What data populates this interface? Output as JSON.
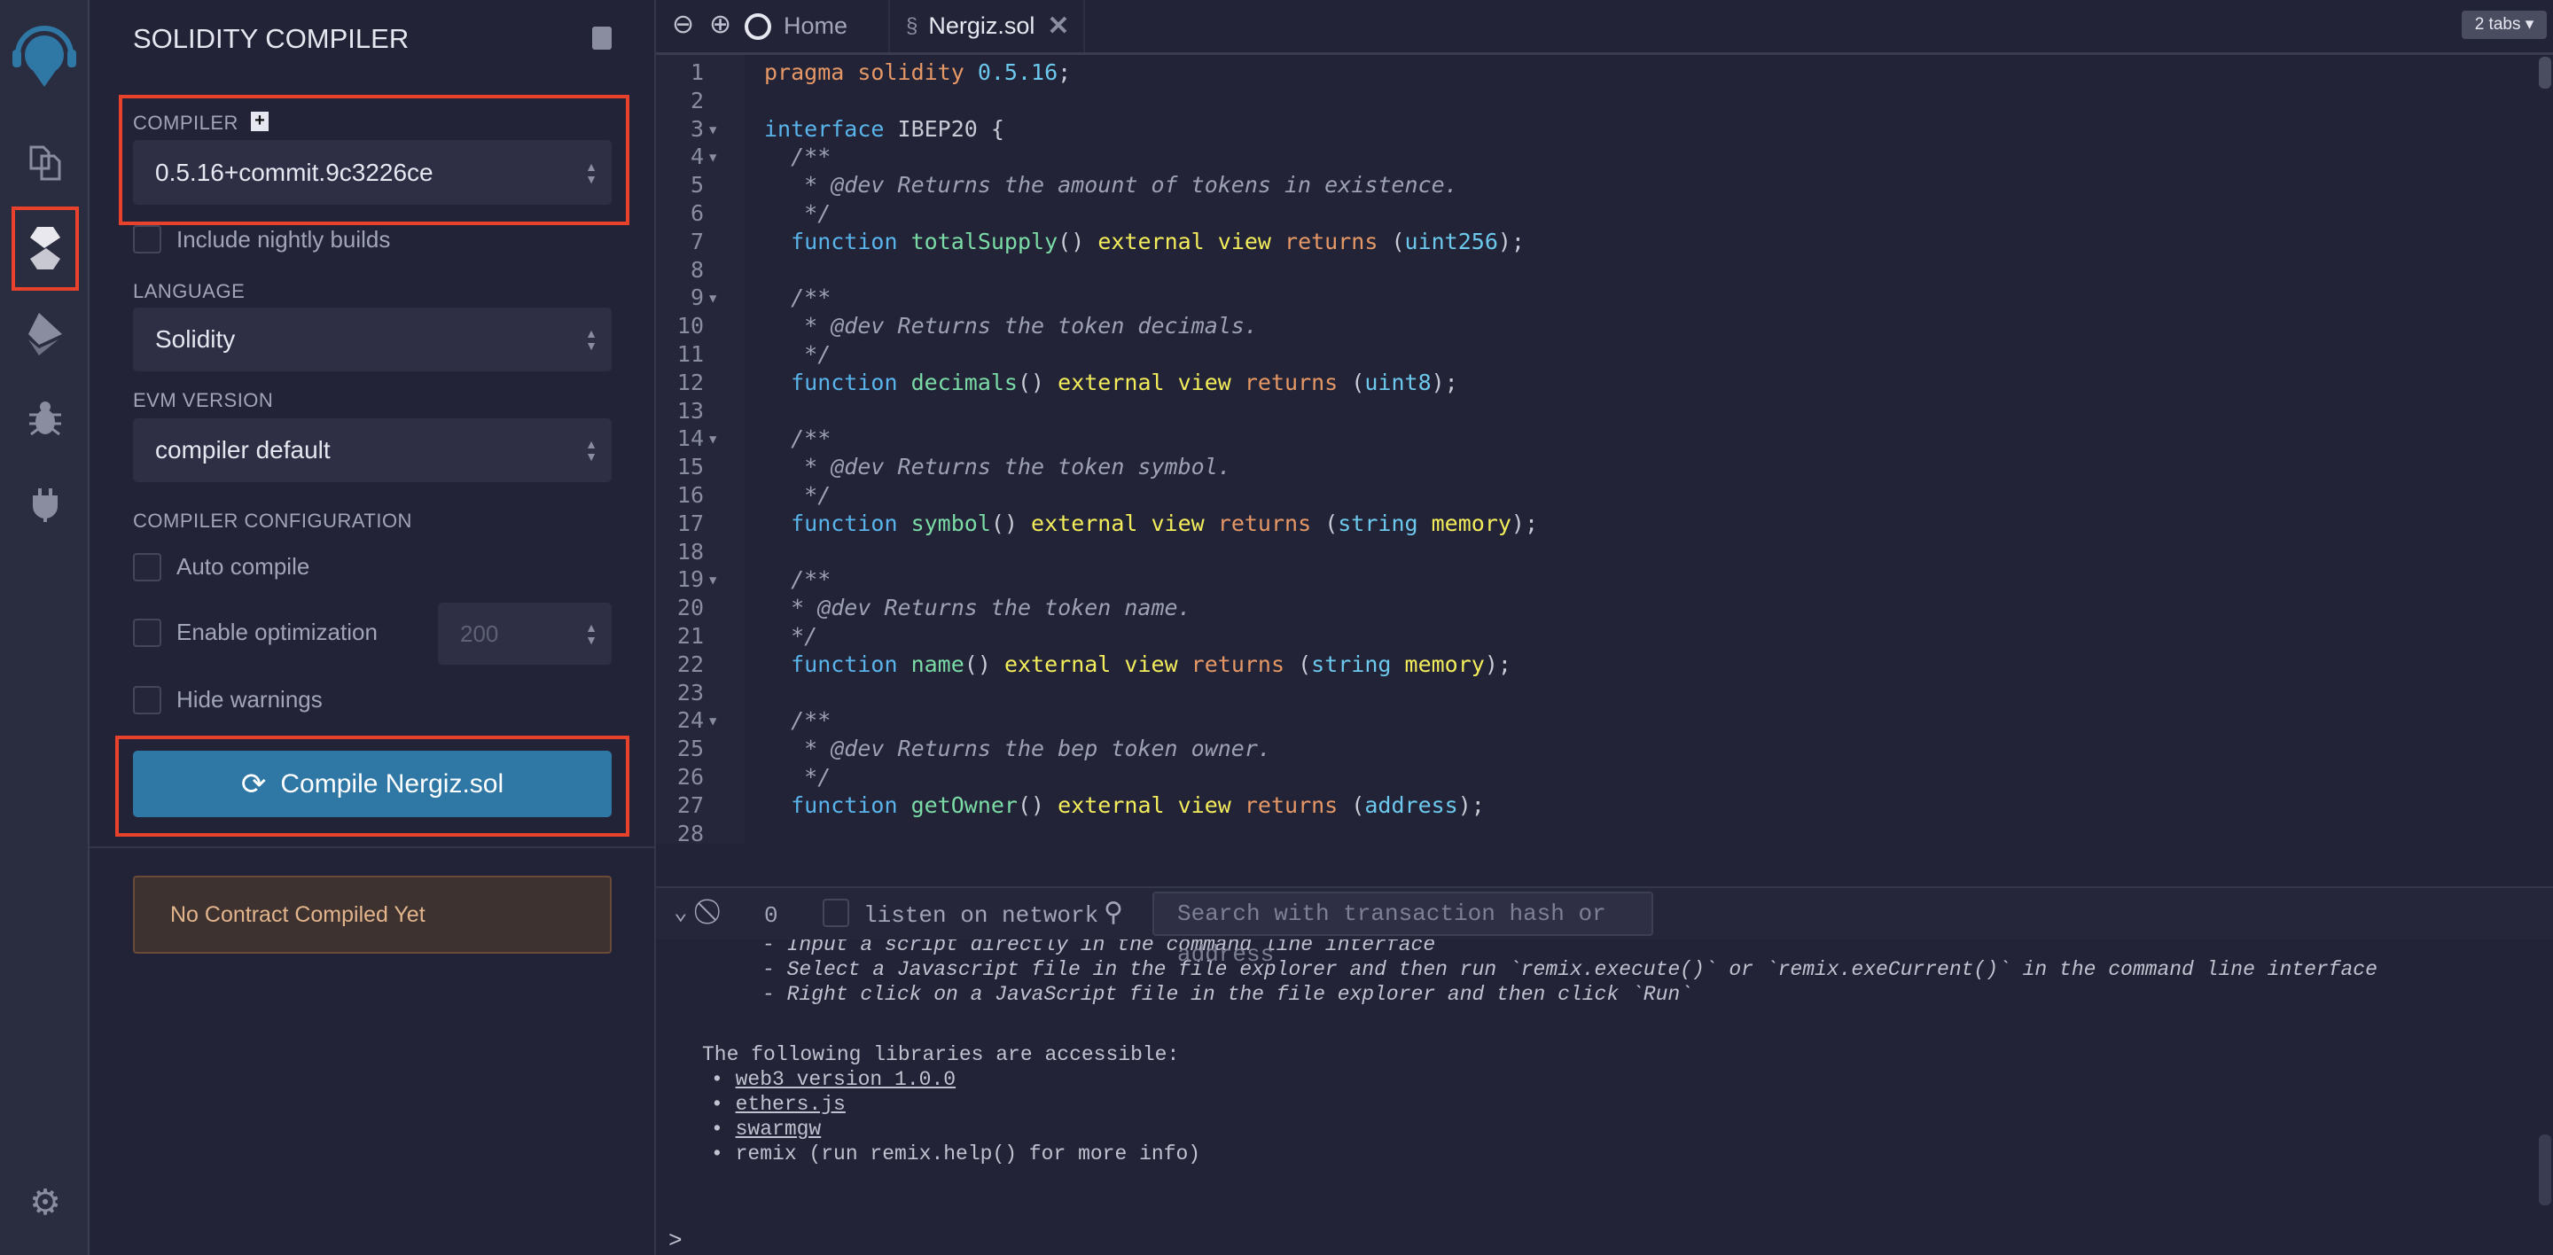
{
  "sidebar": {
    "active": "solidity-compiler"
  },
  "panel": {
    "title": "SOLIDITY COMPILER",
    "compiler_label": "COMPILER",
    "compiler_value": "0.5.16+commit.9c3226ce",
    "nightly_label": "Include nightly builds",
    "language_label": "LANGUAGE",
    "language_value": "Solidity",
    "evm_label": "EVM VERSION",
    "evm_value": "compiler default",
    "config_label": "COMPILER CONFIGURATION",
    "auto_compile": "Auto compile",
    "optimization": "Enable optimization",
    "runs_placeholder": "200",
    "hide_warnings": "Hide warnings",
    "compile_button": "Compile Nergiz.sol",
    "status": "No Contract Compiled Yet",
    "accent": "#2f77a5"
  },
  "tabs": {
    "home": "Home",
    "file": "Nergiz.sol",
    "count": "2 tabs ▾"
  },
  "code": [
    [
      [
        "kw",
        "pragma solidity "
      ],
      [
        "num",
        "0.5.16"
      ],
      [
        "txt",
        ";"
      ]
    ],
    [],
    [
      [
        "blue",
        "interface"
      ],
      [
        "txt",
        " IBEP20 {"
      ]
    ],
    [
      [
        "com",
        "  /**"
      ]
    ],
    [
      [
        "com",
        "   * @dev Returns the amount of tokens in existence."
      ]
    ],
    [
      [
        "com",
        "   */"
      ]
    ],
    [
      [
        "blue",
        "  function "
      ],
      [
        "fn",
        "totalSupply"
      ],
      [
        "txt",
        "() "
      ],
      [
        "yel",
        "external view "
      ],
      [
        "ret",
        "returns "
      ],
      [
        "txt",
        "("
      ],
      [
        "type",
        "uint256"
      ],
      [
        "txt",
        ");"
      ]
    ],
    [],
    [
      [
        "com",
        "  /**"
      ]
    ],
    [
      [
        "com",
        "   * @dev Returns the token decimals."
      ]
    ],
    [
      [
        "com",
        "   */"
      ]
    ],
    [
      [
        "blue",
        "  function "
      ],
      [
        "fn",
        "decimals"
      ],
      [
        "txt",
        "() "
      ],
      [
        "yel",
        "external view "
      ],
      [
        "ret",
        "returns "
      ],
      [
        "txt",
        "("
      ],
      [
        "type",
        "uint8"
      ],
      [
        "txt",
        ");"
      ]
    ],
    [],
    [
      [
        "com",
        "  /**"
      ]
    ],
    [
      [
        "com",
        "   * @dev Returns the token symbol."
      ]
    ],
    [
      [
        "com",
        "   */"
      ]
    ],
    [
      [
        "blue",
        "  function "
      ],
      [
        "fn",
        "symbol"
      ],
      [
        "txt",
        "() "
      ],
      [
        "yel",
        "external view "
      ],
      [
        "ret",
        "returns "
      ],
      [
        "txt",
        "("
      ],
      [
        "type",
        "string "
      ],
      [
        "yel",
        "memory"
      ],
      [
        "txt",
        ");"
      ]
    ],
    [],
    [
      [
        "com",
        "  /**"
      ]
    ],
    [
      [
        "com",
        "  * @dev Returns the token name."
      ]
    ],
    [
      [
        "com",
        "  */"
      ]
    ],
    [
      [
        "blue",
        "  function "
      ],
      [
        "fn",
        "name"
      ],
      [
        "txt",
        "() "
      ],
      [
        "yel",
        "external view "
      ],
      [
        "ret",
        "returns "
      ],
      [
        "txt",
        "("
      ],
      [
        "type",
        "string "
      ],
      [
        "yel",
        "memory"
      ],
      [
        "txt",
        ");"
      ]
    ],
    [],
    [
      [
        "com",
        "  /**"
      ]
    ],
    [
      [
        "com",
        "   * @dev Returns the bep token owner."
      ]
    ],
    [
      [
        "com",
        "   */"
      ]
    ],
    [
      [
        "blue",
        "  function "
      ],
      [
        "fn",
        "getOwner"
      ],
      [
        "txt",
        "() "
      ],
      [
        "yel",
        "external view "
      ],
      [
        "ret",
        "returns "
      ],
      [
        "txt",
        "("
      ],
      [
        "type",
        "address"
      ],
      [
        "txt",
        ");"
      ]
    ],
    []
  ],
  "folds": [
    3,
    4,
    9,
    14,
    19,
    24
  ],
  "terminal": {
    "tx_count": "0",
    "listen_label": "listen on network",
    "search_placeholder": "Search with transaction hash or address",
    "lines": [
      "- Input a script directly in the command line interface",
      "- Select a Javascript file in the file explorer and then run `remix.execute()` or `remix.exeCurrent()` in the command line interface",
      "- Right click on a JavaScript file in the file explorer and then click `Run`"
    ],
    "libs_heading": "The following libraries are accessible:",
    "libs": [
      "web3 version 1.0.0",
      "ethers.js",
      "swarmgw"
    ],
    "remix_line": "remix (run remix.help() for more info)",
    "prompt": ">"
  }
}
